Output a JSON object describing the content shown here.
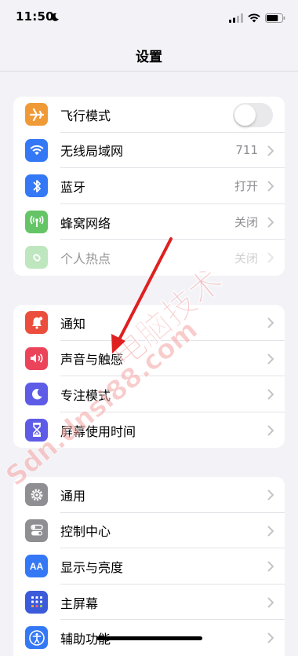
{
  "status_bar": {
    "time": "11:50",
    "battery_percent": 75
  },
  "nav": {
    "title": "设置"
  },
  "groups": [
    {
      "rows": [
        {
          "label": "飞行模式",
          "icon": "airplane-icon",
          "color": "#f09a37",
          "toggle": false
        },
        {
          "label": "无线局域网",
          "icon": "wifi-icon",
          "color": "#3478f6",
          "value": "711"
        },
        {
          "label": "蓝牙",
          "icon": "bluetooth-icon",
          "color": "#3478f6",
          "value": "打开"
        },
        {
          "label": "蜂窝网络",
          "icon": "antenna-icon",
          "color": "#65c466",
          "value": "关闭"
        },
        {
          "label": "个人热点",
          "icon": "hotspot-icon",
          "color": "#65c466",
          "value": "关闭",
          "disabled": true
        }
      ]
    },
    {
      "rows": [
        {
          "label": "通知",
          "icon": "bell-icon",
          "color": "#eb4e3d"
        },
        {
          "label": "声音与触感",
          "icon": "speaker-icon",
          "color": "#eb445a"
        },
        {
          "label": "专注模式",
          "icon": "moon-icon",
          "color": "#5e5ce6"
        },
        {
          "label": "屏幕使用时间",
          "icon": "hourglass-icon",
          "color": "#5e5ce6"
        }
      ]
    },
    {
      "rows": [
        {
          "label": "通用",
          "icon": "gear-icon",
          "color": "#8e8e93"
        },
        {
          "label": "控制中心",
          "icon": "switches-icon",
          "color": "#8e8e93"
        },
        {
          "label": "显示与亮度",
          "icon": "text-size-icon",
          "color": "#3478f6",
          "glyph": "AA"
        },
        {
          "label": "主屏幕",
          "icon": "home-grid-icon",
          "color": "#3b5bdb"
        },
        {
          "label": "辅助功能",
          "icon": "accessibility-icon",
          "color": "#3478f6"
        }
      ]
    }
  ],
  "watermark": {
    "text1": "电脑技术",
    "text2": "Sdn.dnsi88.com"
  }
}
